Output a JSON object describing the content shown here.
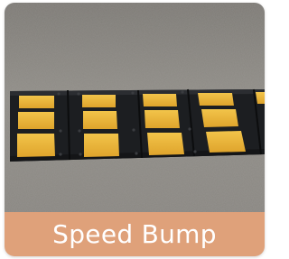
{
  "card": {
    "caption": "Speed Bump",
    "caption_bg_color": "#dfa17a",
    "caption_text_color": "#ffffff",
    "photo_icon": "speed-bump-photo",
    "colors": {
      "asphalt": "#8d8a84",
      "bump_black": "#1d1f22",
      "bump_yellow": "#e8b43a"
    }
  }
}
